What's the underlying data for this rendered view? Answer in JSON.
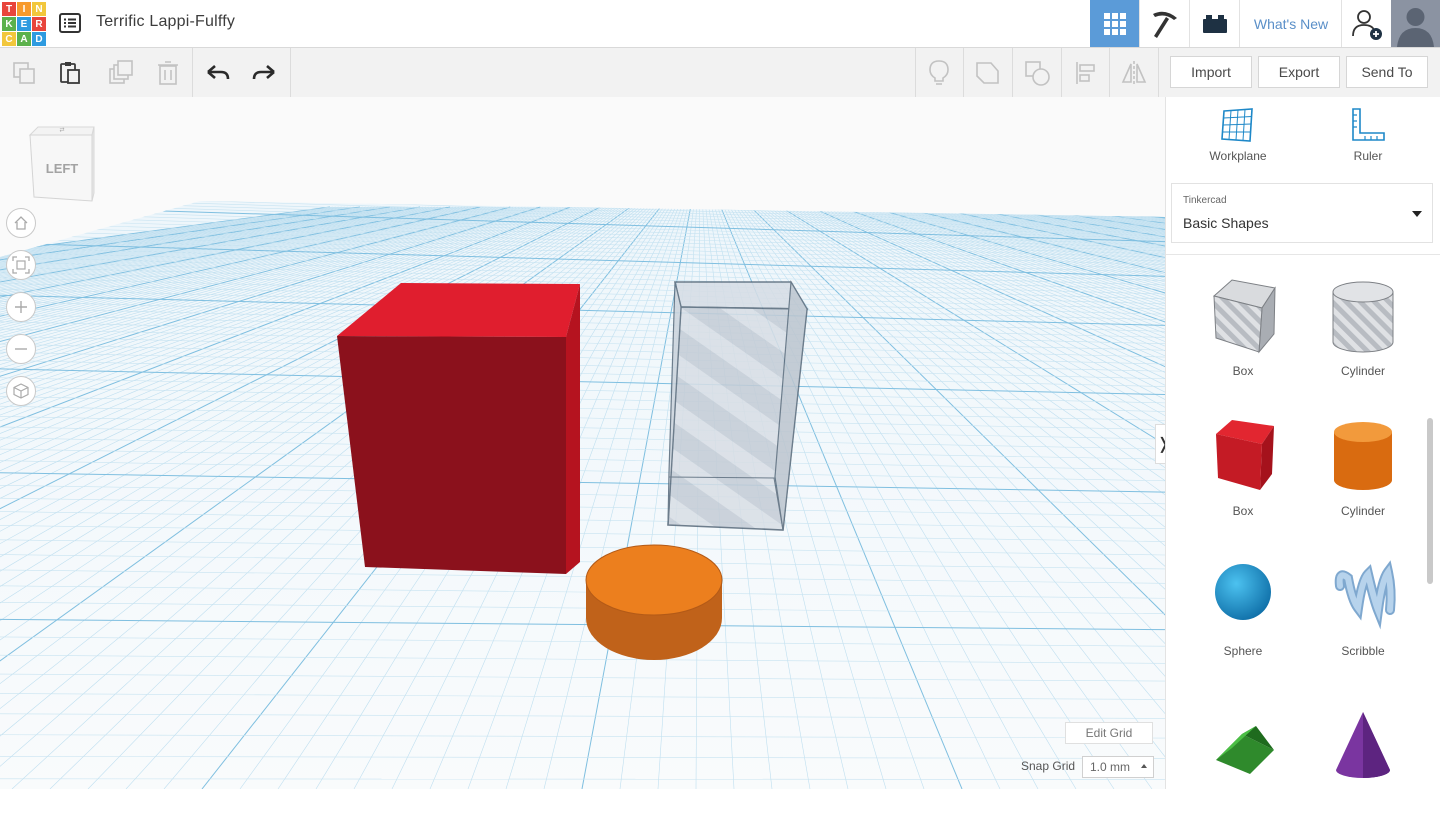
{
  "app": {
    "logo_letters": [
      "T",
      "I",
      "N",
      "K",
      "E",
      "R",
      "C",
      "A",
      "D"
    ],
    "logo_colors": [
      "#e8453c",
      "#f79a2c",
      "#f2c73c",
      "#5bb14c",
      "#2e9be0",
      "#e8453c",
      "#f2c73c",
      "#5bb14c",
      "#2e9be0"
    ],
    "design_title": "Terrific Lappi-Fulffy",
    "accent_color": "#5b9bd8"
  },
  "header": {
    "whats_new_label": "What's New",
    "icons": [
      "design-list-icon",
      "grid-view-icon",
      "pickaxe-icon",
      "bricks-icon",
      "add-user-icon",
      "user-avatar"
    ]
  },
  "toolbar": {
    "tools": [
      "copy-icon",
      "paste-icon",
      "duplicate-icon",
      "delete-icon",
      "undo-icon",
      "redo-icon",
      "notes-icon",
      "group-icon",
      "ungroup-icon",
      "align-icon",
      "mirror-icon"
    ],
    "import_label": "Import",
    "export_label": "Export",
    "send_to_label": "Send To"
  },
  "viewport": {
    "view_cube_label": "LEFT",
    "nav_buttons": [
      "home-view",
      "fit-all",
      "zoom-in",
      "zoom-out",
      "perspective-toggle"
    ],
    "edit_grid_label": "Edit Grid",
    "snap_grid_label": "Snap Grid",
    "snap_grid_value": "1.0 mm",
    "objects": [
      {
        "shape": "box",
        "color": "#d91e2e"
      },
      {
        "shape": "box-hole",
        "color": "#b9c3cf"
      },
      {
        "shape": "cylinder",
        "color": "#ec7f1e"
      }
    ]
  },
  "right_panel": {
    "workplane_label": "Workplane",
    "ruler_label": "Ruler",
    "library_group": "Tinkercad",
    "library_name": "Basic Shapes",
    "shapes": [
      {
        "label": "Box",
        "color": "#c6c9ce"
      },
      {
        "label": "Cylinder",
        "color": "#c6c9ce"
      },
      {
        "label": "Box",
        "color": "#d2232a"
      },
      {
        "label": "Cylinder",
        "color": "#ef7d1a"
      },
      {
        "label": "Sphere",
        "color": "#1b9ad6"
      },
      {
        "label": "Scribble",
        "color": "#9ec2e2"
      },
      {
        "label": "",
        "color": "#3fa33a"
      },
      {
        "label": "",
        "color": "#7b3aa0"
      }
    ]
  }
}
